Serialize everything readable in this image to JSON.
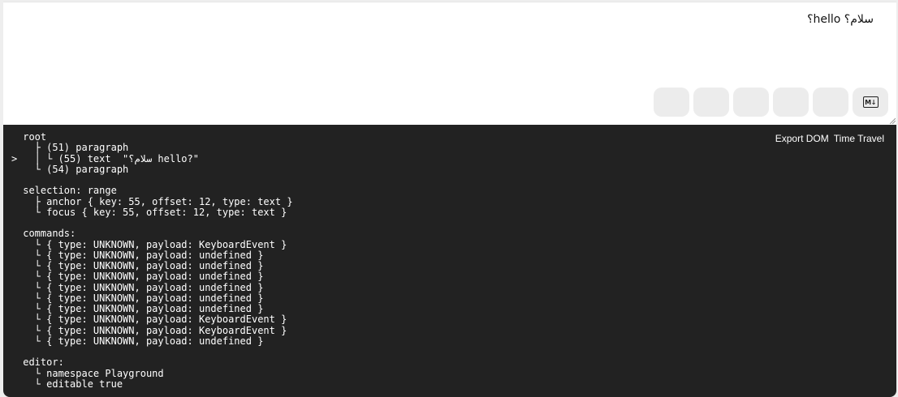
{
  "editor": {
    "content": "سلام؟ hello؟"
  },
  "toolbar": {
    "buttons": [
      "",
      "",
      "",
      "",
      ""
    ],
    "markdown_icon": "markdown-icon",
    "markdown_glyph": "M↓"
  },
  "tree_view": {
    "export_dom_label": "Export DOM",
    "time_travel_label": "Time Travel",
    "lines": [
      {
        "marker": " ",
        "text": "root"
      },
      {
        "marker": " ",
        "text": "  ├ (51) paragraph"
      },
      {
        "marker": ">",
        "text": "  │ └ (55) text  \"سلام؟ hello?\""
      },
      {
        "marker": " ",
        "text": "  └ (54) paragraph"
      },
      {
        "marker": " ",
        "text": ""
      },
      {
        "marker": " ",
        "text": "selection: range"
      },
      {
        "marker": " ",
        "text": "  ├ anchor { key: 55, offset: 12, type: text }"
      },
      {
        "marker": " ",
        "text": "  └ focus { key: 55, offset: 12, type: text }"
      },
      {
        "marker": " ",
        "text": ""
      },
      {
        "marker": " ",
        "text": "commands:"
      },
      {
        "marker": " ",
        "text": "  └ { type: UNKNOWN, payload: KeyboardEvent }"
      },
      {
        "marker": " ",
        "text": "  └ { type: UNKNOWN, payload: undefined }"
      },
      {
        "marker": " ",
        "text": "  └ { type: UNKNOWN, payload: undefined }"
      },
      {
        "marker": " ",
        "text": "  └ { type: UNKNOWN, payload: undefined }"
      },
      {
        "marker": " ",
        "text": "  └ { type: UNKNOWN, payload: undefined }"
      },
      {
        "marker": " ",
        "text": "  └ { type: UNKNOWN, payload: undefined }"
      },
      {
        "marker": " ",
        "text": "  └ { type: UNKNOWN, payload: undefined }"
      },
      {
        "marker": " ",
        "text": "  └ { type: UNKNOWN, payload: KeyboardEvent }"
      },
      {
        "marker": " ",
        "text": "  └ { type: UNKNOWN, payload: KeyboardEvent }"
      },
      {
        "marker": " ",
        "text": "  └ { type: UNKNOWN, payload: undefined }"
      },
      {
        "marker": " ",
        "text": ""
      },
      {
        "marker": " ",
        "text": "editor:"
      },
      {
        "marker": " ",
        "text": "  └ namespace Playground"
      },
      {
        "marker": " ",
        "text": "  └ editable true"
      }
    ]
  }
}
